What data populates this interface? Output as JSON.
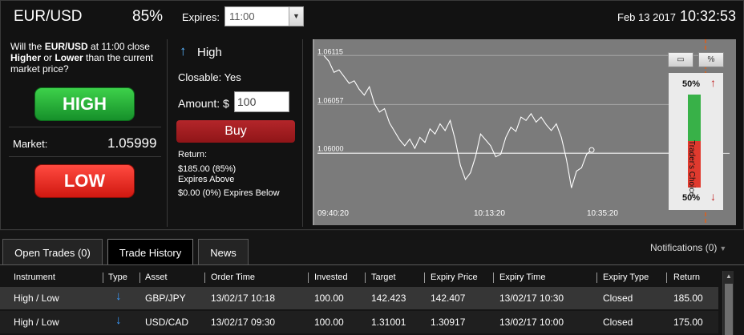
{
  "header": {
    "asset": "EUR/USD",
    "payout": "85%",
    "expires_label": "Expires:",
    "expires_value": "11:00",
    "date": "Feb 13 2017",
    "time": "10:32:53"
  },
  "question": {
    "pre": "Will the ",
    "asset": "EUR/USD",
    "mid": " at 11:00 close ",
    "higher": "Higher",
    "or": " or ",
    "lower": "Lower",
    "post": " than the current market price?"
  },
  "buttons": {
    "high": "HIGH",
    "low": "LOW",
    "buy": "Buy"
  },
  "market": {
    "label": "Market:",
    "value": "1.05999"
  },
  "order": {
    "direction": "High",
    "closable": "Closable: Yes",
    "amount_label": "Amount: $",
    "amount_value": "100",
    "return_label": "Return:",
    "return_above_value": "$185.00 (85%)",
    "return_above_text": "Expires Above",
    "return_below": "$0.00 (0%) Expires Below"
  },
  "chart_data": {
    "type": "line",
    "y_ticks": [
      "1.06115",
      "1.06057",
      "1.06000"
    ],
    "x_ticks": [
      "09:40:20",
      "10:13:20",
      "10:35:20"
    ],
    "x": [
      "09:40:20",
      "10:13:20",
      "10:35:20"
    ],
    "ylim": [
      1.0593,
      1.0612
    ],
    "price_series": [
      1.06115,
      1.06108,
      1.06095,
      1.06098,
      1.0609,
      1.06082,
      1.06085,
      1.06075,
      1.06068,
      1.06078,
      1.06058,
      1.06048,
      1.06052,
      1.06035,
      1.06025,
      1.06015,
      1.06008,
      1.06016,
      1.06005,
      1.06018,
      1.06012,
      1.06028,
      1.06022,
      1.06034,
      1.06026,
      1.06038,
      1.06015,
      1.05985,
      1.05968,
      1.05976,
      1.05995,
      1.06022,
      1.06015,
      1.06008,
      1.05995,
      1.05998,
      1.06018,
      1.0603,
      1.06025,
      1.06042,
      1.06038,
      1.06046,
      1.06036,
      1.06042,
      1.06033,
      1.06026,
      1.06034,
      1.06018,
      1.05992,
      1.05958,
      1.05978,
      1.05982,
      1.05998,
      1.06003
    ],
    "current_price": 1.05999,
    "traders_choice": {
      "top_pct": "50%",
      "bottom_pct": "50%",
      "label": "Trader's Choice",
      "high_fraction": 0.5
    }
  },
  "chart_icons": [
    "window-icon",
    "percent-icon"
  ],
  "tabs": [
    {
      "label": "Open Trades (0)",
      "active": false
    },
    {
      "label": "Trade History",
      "active": true
    },
    {
      "label": "News",
      "active": false
    }
  ],
  "notifications": "Notifications (0)",
  "table": {
    "headers": [
      "Instrument",
      "Type",
      "Asset",
      "Order Time",
      "Invested",
      "Target",
      "Expiry Price",
      "Expiry Time",
      "Expiry Type",
      "Return"
    ],
    "rows": [
      {
        "instrument": "High / Low",
        "type_icon": "arrow-down-icon",
        "asset": "GBP/JPY",
        "order_time": "13/02/17 10:18",
        "invested": "100.00",
        "target": "142.423",
        "expiry_price": "142.407",
        "expiry_time": "13/02/17 10:30",
        "expiry_type": "Closed",
        "return": "185.00"
      },
      {
        "instrument": "High / Low",
        "type_icon": "arrow-down-icon",
        "asset": "USD/CAD",
        "order_time": "13/02/17 09:30",
        "invested": "100.00",
        "target": "1.31001",
        "expiry_price": "1.30917",
        "expiry_time": "13/02/17 10:00",
        "expiry_type": "Closed",
        "return": "175.00"
      }
    ]
  }
}
